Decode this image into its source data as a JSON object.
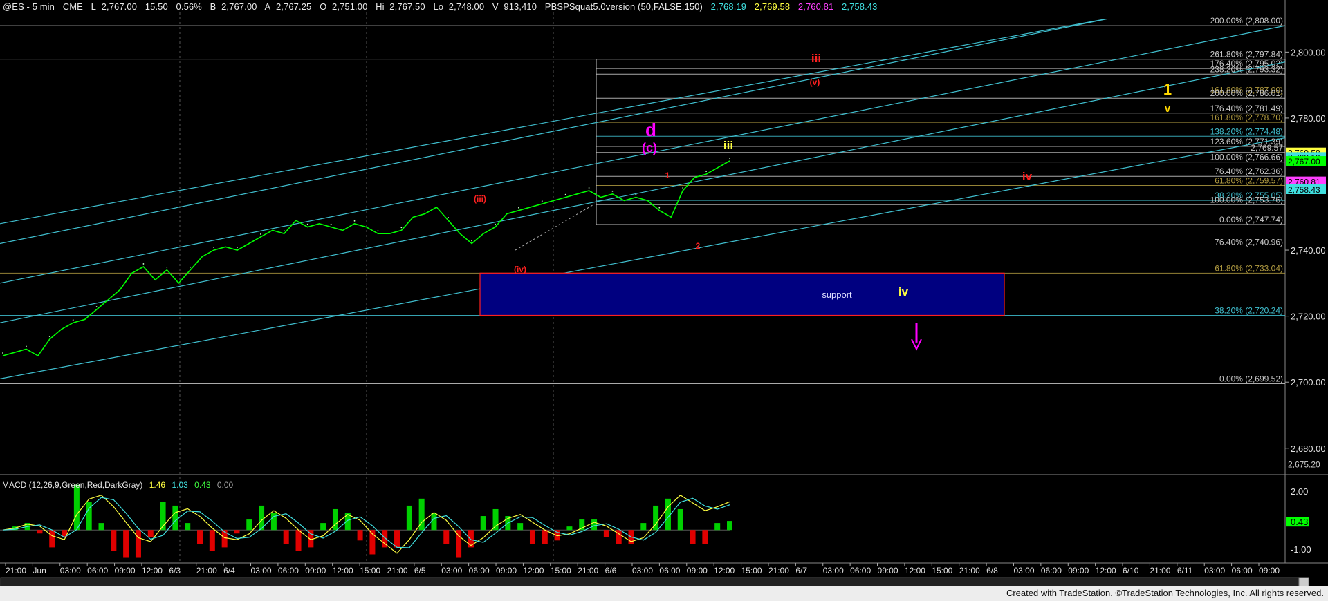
{
  "header": {
    "symbol": "@ES - 5 min",
    "exchange": "CME",
    "last": "L=2,767.00",
    "change": "15.50",
    "change_pct": "0.56%",
    "bid": "B=2,767.00",
    "ask": "A=2,767.25",
    "open": "O=2,751.00",
    "high": "Hi=2,767.50",
    "low": "Lo=2,748.00",
    "volume": "V=913,410",
    "study": "PBSPSquat5.0version (50,FALSE,150)",
    "study_values": [
      {
        "text": "2,768.19",
        "color": "#40e0e0"
      },
      {
        "text": "2,769.58",
        "color": "#ffff40"
      },
      {
        "text": "2,760.81",
        "color": "#ff40ff"
      },
      {
        "text": "2,758.43",
        "color": "#40e0e0"
      }
    ]
  },
  "macd": {
    "label": "MACD (12,26,9,Green,Red,DarkGray)",
    "values": [
      {
        "text": "1.46",
        "color": "#ffff40"
      },
      {
        "text": "1.03",
        "color": "#40e0e0"
      },
      {
        "text": "0.43",
        "color": "#40ff40"
      },
      {
        "text": "0.00",
        "color": "#a0a0a0"
      }
    ],
    "axis": [
      "2.00",
      "0.43",
      "-1.00"
    ]
  },
  "footer": "Created with TradeStation. ©TradeStation Technologies, Inc. All rights reserved.",
  "colors": {
    "price": "#00ff00",
    "channel": "#40c0d0",
    "fib": "#c8c8c8",
    "support": "#000080"
  },
  "chart_data": {
    "type": "line",
    "title": "@ES - 5 min",
    "y_axis": [
      "2,800.00",
      "2,780.00",
      "2,760.00",
      "2,740.00",
      "2,720.00",
      "2,700.00",
      "2,680.00"
    ],
    "ylim": [
      2672,
      2812
    ],
    "x_ticks": [
      "21:00",
      "Jun",
      "03:00",
      "06:00",
      "09:00",
      "12:00",
      "6/3",
      "21:00",
      "6/4",
      "03:00",
      "06:00",
      "09:00",
      "12:00",
      "15:00",
      "21:00",
      "6/5",
      "03:00",
      "06:00",
      "09:00",
      "12:00",
      "15:00",
      "21:00",
      "6/6",
      "03:00",
      "06:00",
      "09:00",
      "12:00",
      "15:00",
      "21:00",
      "6/7",
      "03:00",
      "06:00",
      "09:00",
      "12:00",
      "15:00",
      "21:00",
      "6/8",
      "03:00",
      "06:00",
      "09:00",
      "12:00",
      "6/10",
      "21:00",
      "6/11",
      "03:00",
      "06:00",
      "09:00"
    ],
    "axis_tags": [
      {
        "text": "2,769.58",
        "value": 2769.58,
        "bg": "#ffff40",
        "fg": "#000"
      },
      {
        "text": "2,768.19",
        "value": 2768.19,
        "bg": "#40e0e0",
        "fg": "#000"
      },
      {
        "text": "2,767.00",
        "value": 2767.0,
        "bg": "#00ff00",
        "fg": "#000"
      },
      {
        "text": "2,760.81",
        "value": 2760.81,
        "bg": "#ff40ff",
        "fg": "#000"
      },
      {
        "text": "2,758.43",
        "value": 2758.43,
        "bg": "#40e0e0",
        "fg": "#000"
      },
      {
        "text": "2,675.20",
        "value": 2675.2,
        "bg": "none",
        "fg": "#ccc"
      }
    ],
    "fib_levels": [
      {
        "text": "200.00% (2,808.00)",
        "value": 2808.0,
        "color": "#c8c8c8"
      },
      {
        "text": "261.80% (2,797.84)",
        "value": 2797.84,
        "color": "#c8c8c8"
      },
      {
        "text": "176.40% (2,795.02)",
        "value": 2795.02,
        "color": "#c8c8c8"
      },
      {
        "text": "238.20% (2,793.32)",
        "value": 2793.32,
        "color": "#c8c8c8"
      },
      {
        "text": "161.80% (2,787.00)",
        "value": 2787.0,
        "color": "#b09a40"
      },
      {
        "text": "200.00% (2,786.01)",
        "value": 2786.01,
        "color": "#c8c8c8"
      },
      {
        "text": "176.40% (2,781.49)",
        "value": 2781.49,
        "color": "#c8c8c8"
      },
      {
        "text": "161.80% (2,778.70)",
        "value": 2778.7,
        "color": "#b09a40"
      },
      {
        "text": "138.20% (2,774.48)",
        "value": 2774.48,
        "color": "#40c0d0"
      },
      {
        "text": "123.60% (2,771.39)",
        "value": 2771.39,
        "color": "#c8c8c8"
      },
      {
        "text": "2,769.57",
        "value": 2769.57,
        "color": "#c8c8c8"
      },
      {
        "text": "100.00% (2,766.66)",
        "value": 2766.66,
        "color": "#c8c8c8"
      },
      {
        "text": "76.40% (2,762.36)",
        "value": 2762.36,
        "color": "#c8c8c8"
      },
      {
        "text": "61.80% (2,759.57)",
        "value": 2759.57,
        "color": "#b09a40"
      },
      {
        "text": "38.20% (2,755.05)",
        "value": 2755.05,
        "color": "#40c0d0"
      },
      {
        "text": "100.00% (2,753.76)",
        "value": 2753.76,
        "color": "#c8c8c8"
      },
      {
        "text": "0.00% (2,747.74)",
        "value": 2747.74,
        "color": "#c8c8c8"
      },
      {
        "text": "76.40% (2,740.96)",
        "value": 2740.96,
        "color": "#c8c8c8"
      },
      {
        "text": "61.80% (2,733.04)",
        "value": 2733.04,
        "color": "#b09a40"
      },
      {
        "text": "38.20% (2,720.24)",
        "value": 2720.24,
        "color": "#40c0d0"
      },
      {
        "text": "0.00% (2,699.52)",
        "value": 2699.52,
        "color": "#c8c8c8"
      }
    ],
    "support_zone": {
      "label": "support",
      "top": 2733.04,
      "bottom": 2720.24
    },
    "wave_labels": [
      {
        "text": "iii",
        "color": "#ff2020"
      },
      {
        "text": "(v)",
        "color": "#ff2020"
      },
      {
        "text": "1",
        "color": "#ffd700"
      },
      {
        "text": "v",
        "color": "#ffd700"
      },
      {
        "text": "d",
        "color": "#ff00ff"
      },
      {
        "text": "(c)",
        "color": "#ff00ff"
      },
      {
        "text": "iii",
        "color": "#ffff40"
      },
      {
        "text": "1",
        "color": "#ff2020"
      },
      {
        "text": "iv",
        "color": "#ff2020"
      },
      {
        "text": "(iii)",
        "color": "#ff2020"
      },
      {
        "text": "(iv)",
        "color": "#ff2020"
      },
      {
        "text": "2",
        "color": "#ff2020"
      },
      {
        "text": "iv",
        "color": "#ffff40"
      }
    ],
    "price_points": [
      [
        0,
        2708
      ],
      [
        2,
        2709
      ],
      [
        4,
        2710
      ],
      [
        6,
        2708
      ],
      [
        8,
        2713
      ],
      [
        10,
        2716
      ],
      [
        12,
        2718
      ],
      [
        14,
        2719
      ],
      [
        16,
        2722
      ],
      [
        18,
        2725
      ],
      [
        20,
        2728
      ],
      [
        22,
        2733
      ],
      [
        24,
        2735
      ],
      [
        26,
        2731
      ],
      [
        28,
        2734
      ],
      [
        30,
        2730
      ],
      [
        32,
        2734
      ],
      [
        34,
        2738
      ],
      [
        36,
        2740
      ],
      [
        38,
        2741
      ],
      [
        40,
        2740
      ],
      [
        42,
        2742
      ],
      [
        44,
        2744
      ],
      [
        46,
        2746
      ],
      [
        48,
        2745
      ],
      [
        50,
        2749
      ],
      [
        52,
        2747
      ],
      [
        54,
        2748
      ],
      [
        56,
        2747
      ],
      [
        58,
        2746
      ],
      [
        60,
        2748
      ],
      [
        62,
        2747
      ],
      [
        64,
        2745
      ],
      [
        66,
        2745
      ],
      [
        68,
        2746
      ],
      [
        70,
        2750
      ],
      [
        72,
        2751
      ],
      [
        74,
        2753
      ],
      [
        76,
        2749
      ],
      [
        78,
        2745
      ],
      [
        80,
        2742
      ],
      [
        82,
        2745
      ],
      [
        84,
        2747
      ],
      [
        86,
        2751
      ],
      [
        88,
        2752
      ],
      [
        90,
        2753
      ],
      [
        92,
        2754
      ],
      [
        94,
        2755
      ],
      [
        96,
        2756
      ],
      [
        98,
        2757
      ],
      [
        100,
        2758
      ],
      [
        102,
        2756
      ],
      [
        104,
        2757
      ],
      [
        106,
        2755
      ],
      [
        108,
        2756
      ],
      [
        110,
        2755
      ],
      [
        112,
        2752
      ],
      [
        114,
        2750
      ],
      [
        116,
        2758
      ],
      [
        118,
        2762
      ],
      [
        120,
        2763
      ],
      [
        122,
        2765
      ],
      [
        124,
        2767
      ]
    ],
    "macd_line": [
      0,
      0.1,
      0.3,
      0.2,
      -0.3,
      -0.5,
      0.8,
      1.6,
      1.8,
      1.2,
      0.4,
      -0.4,
      -0.6,
      0.2,
      0.9,
      1.1,
      0.7,
      0.1,
      -0.4,
      -0.5,
      -0.2,
      0.5,
      1.0,
      0.6,
      0.0,
      -0.5,
      -0.3,
      0.3,
      0.8,
      0.5,
      -0.2,
      -0.7,
      -1.2,
      -0.5,
      0.4,
      0.9,
      0.5,
      -0.3,
      -0.8,
      -0.4,
      0.2,
      0.6,
      0.8,
      0.4,
      0.0,
      -0.3,
      -0.2,
      0.1,
      0.4,
      0.2,
      -0.2,
      -0.6,
      -0.4,
      0.3,
      1.2,
      1.8,
      1.4,
      1.0,
      1.2,
      1.46
    ]
  }
}
